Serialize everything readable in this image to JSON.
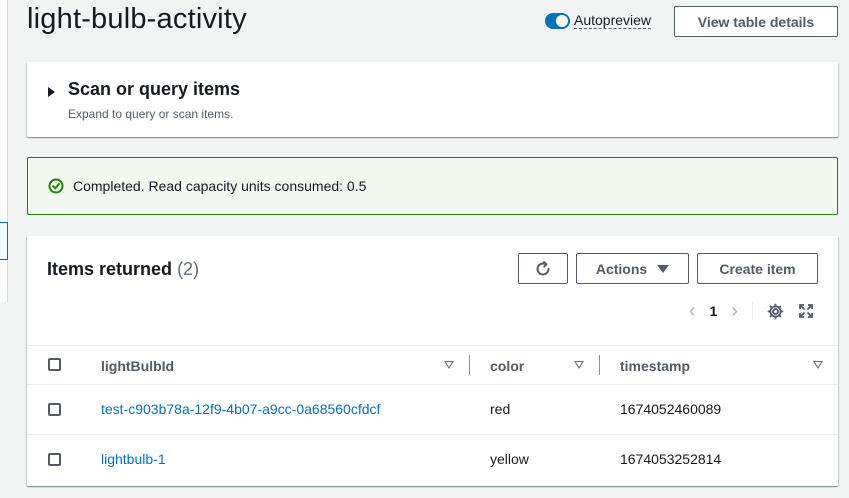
{
  "header": {
    "title": "light-bulb-activity",
    "autopreview_label": "Autopreview",
    "view_table_details_label": "View table details"
  },
  "scan": {
    "title": "Scan or query items",
    "subtitle": "Expand to query or scan items."
  },
  "alert": {
    "message": "Completed. Read capacity units consumed: 0.5",
    "color": "#1d8102"
  },
  "items": {
    "title": "Items returned",
    "count": "(2)",
    "actions_label": "Actions",
    "create_label": "Create item",
    "page": "1",
    "columns": [
      "lightBulbId",
      "color",
      "timestamp"
    ],
    "rows": [
      {
        "lightBulbId": "test-c903b78a-12f9-4b07-a9cc-0a68560cfdcf",
        "color": "red",
        "timestamp": "1674052460089"
      },
      {
        "lightBulbId": "lightbulb-1",
        "color": "yellow",
        "timestamp": "1674053252814"
      }
    ]
  },
  "colors": {
    "accent": "#0073bb",
    "success": "#1d8102",
    "text": "#16191f",
    "muted": "#545b64"
  },
  "icons": [
    "toggle-icon",
    "caret-right-icon",
    "check-circle-icon",
    "refresh-icon",
    "caret-down-icon",
    "chevron-left-icon",
    "chevron-right-icon",
    "gear-icon",
    "fullscreen-icon",
    "sort-icon"
  ]
}
